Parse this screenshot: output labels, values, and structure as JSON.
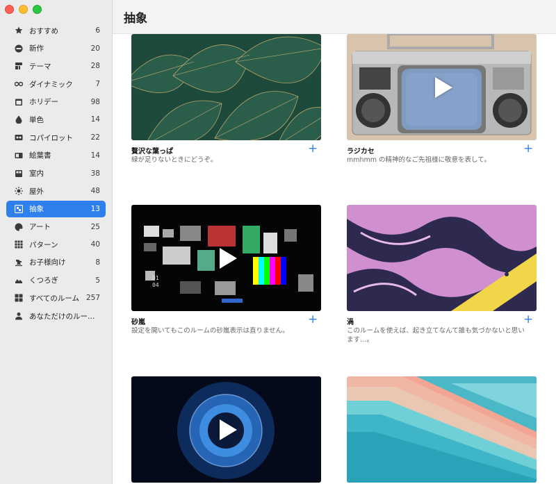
{
  "window": {
    "title": "抽象"
  },
  "sidebar": {
    "items": [
      {
        "label": "おすすめ",
        "count": "6",
        "icon": "star-icon"
      },
      {
        "label": "新作",
        "count": "20",
        "icon": "new-icon"
      },
      {
        "label": "テーマ",
        "count": "28",
        "icon": "theme-icon"
      },
      {
        "label": "ダイナミック",
        "count": "7",
        "icon": "infinity-icon"
      },
      {
        "label": "ホリデー",
        "count": "98",
        "icon": "calendar-icon"
      },
      {
        "label": "単色",
        "count": "14",
        "icon": "drop-icon"
      },
      {
        "label": "コパイロット",
        "count": "22",
        "icon": "copilot-icon"
      },
      {
        "label": "絵葉書",
        "count": "14",
        "icon": "postcard-icon"
      },
      {
        "label": "室内",
        "count": "38",
        "icon": "indoor-icon"
      },
      {
        "label": "屋外",
        "count": "48",
        "icon": "sun-icon"
      },
      {
        "label": "抽象",
        "count": "13",
        "icon": "abstract-icon",
        "active": true
      },
      {
        "label": "アート",
        "count": "25",
        "icon": "palette-icon"
      },
      {
        "label": "パターン",
        "count": "40",
        "icon": "pattern-icon"
      },
      {
        "label": "お子様向け",
        "count": "8",
        "icon": "rocking-horse-icon"
      },
      {
        "label": "くつろぎ",
        "count": "5",
        "icon": "relax-icon"
      },
      {
        "label": "すべてのルーム",
        "count": "257",
        "icon": "grid-icon"
      },
      {
        "label": "あなただけのルー…",
        "count": "",
        "icon": "person-icon"
      }
    ]
  },
  "cards": [
    {
      "title": "贅沢な葉っぱ",
      "desc": "緑が足りないときにどうぞ。",
      "thumb": "leaves"
    },
    {
      "title": "ラジカセ",
      "desc": "mmhmm の精神的なご先祖様に敬意を表して。",
      "thumb": "boombox"
    },
    {
      "title": "砂嵐",
      "desc": "設定を開いてもこのルームの砂嵐表示は直りません。",
      "thumb": "static"
    },
    {
      "title": "渦",
      "desc": "このルームを使えば、起き立てなんて誰も気づかないと思います…。",
      "thumb": "swirl"
    },
    {
      "title": "",
      "desc": "",
      "thumb": "blue-nebula"
    },
    {
      "title": "",
      "desc": "",
      "thumb": "layers"
    }
  ],
  "colors": {
    "accent": "#2f80ed",
    "sidebar_bg": "#ebebeb"
  }
}
